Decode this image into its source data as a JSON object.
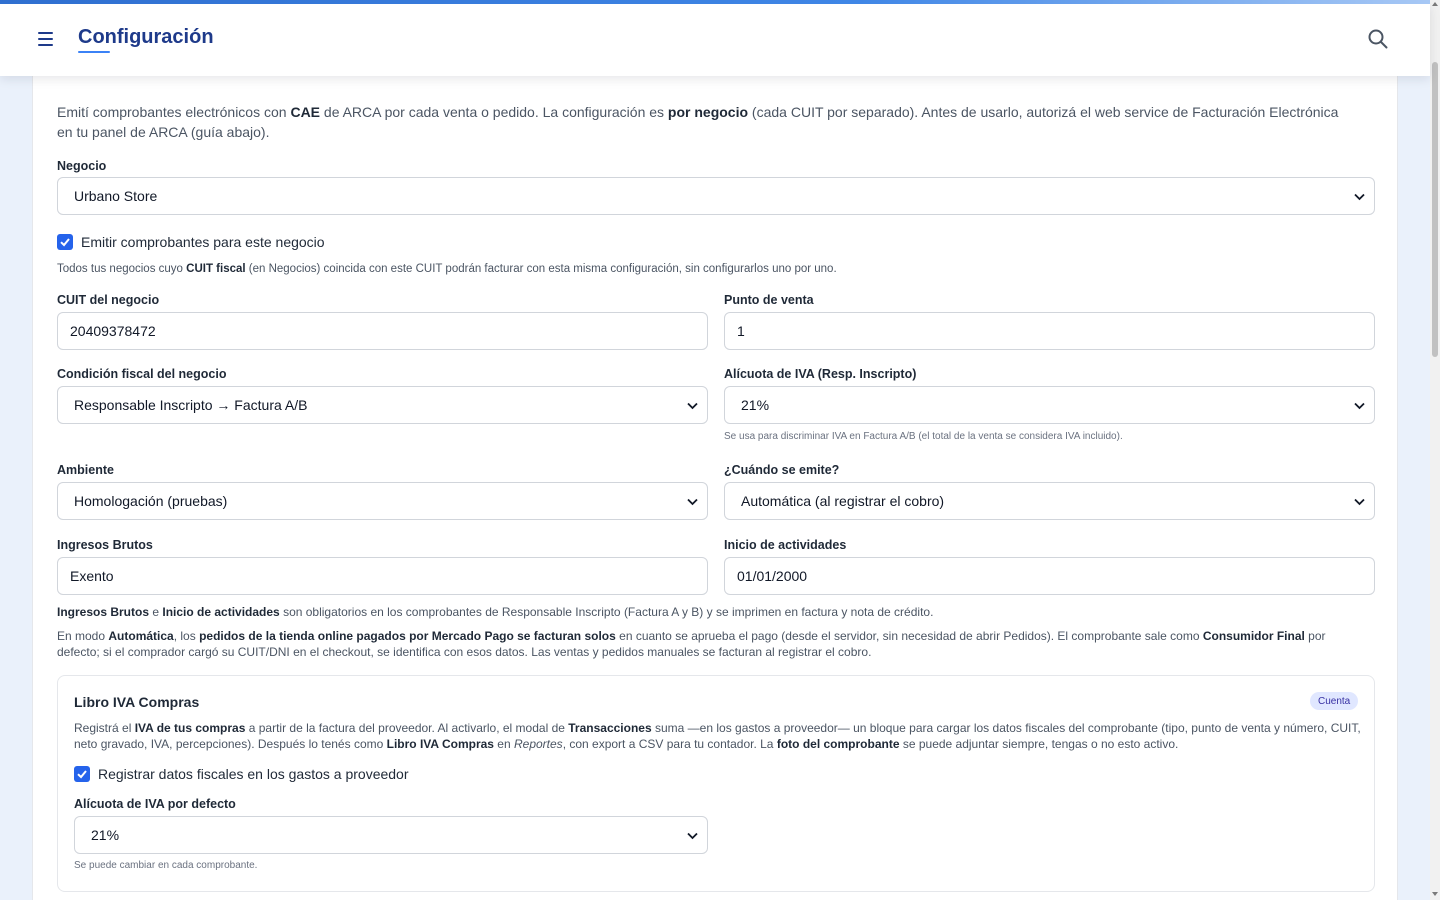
{
  "header": {
    "title": "Configuración"
  },
  "intro": {
    "p1": "Emití comprobantes electrónicos con ",
    "b1": "CAE",
    "p2": " de ARCA por cada venta o pedido. La configuración es ",
    "b2": "por negocio",
    "p3": " (cada CUIT por separado). Antes de usarlo, autorizá el web service de Facturación Electrónica en tu panel de ARCA (guía abajo)."
  },
  "negocio": {
    "label": "Negocio",
    "value": "Urbano Store"
  },
  "emitir": {
    "label": "Emitir comprobantes para este negocio",
    "checked": true,
    "hint_p1": "Todos tus negocios cuyo ",
    "hint_b1": "CUIT fiscal",
    "hint_p2": " (en Negocios) coincida con este CUIT podrán facturar con esta misma configuración, sin configurarlos uno por uno."
  },
  "cuit": {
    "label": "CUIT del negocio",
    "value": "20409378472"
  },
  "punto_venta": {
    "label": "Punto de venta",
    "value": "1"
  },
  "condicion": {
    "label": "Condición fiscal del negocio",
    "value": "Responsable Inscripto → Factura A/B"
  },
  "alicuota": {
    "label": "Alícuota de IVA (Resp. Inscripto)",
    "value": "21%",
    "hint": "Se usa para discriminar IVA en Factura A/B (el total de la venta se considera IVA incluido)."
  },
  "ambiente": {
    "label": "Ambiente",
    "value": "Homologación (pruebas)"
  },
  "cuando": {
    "label": "¿Cuándo se emite?",
    "value": "Automática (al registrar el cobro)"
  },
  "ingresos": {
    "label": "Ingresos Brutos",
    "value": "Exento"
  },
  "inicio": {
    "label": "Inicio de actividades",
    "value": "01/01/2000"
  },
  "note1": {
    "b1": "Ingresos Brutos",
    "p1": " e ",
    "b2": "Inicio de actividades",
    "p2": " son obligatorios en los comprobantes de Responsable Inscripto (Factura A y B) y se imprimen en factura y nota de crédito."
  },
  "note2": {
    "p1": "En modo ",
    "b1": "Automática",
    "p2": ", los ",
    "b2": "pedidos de la tienda online pagados por Mercado Pago se facturan solos",
    "p3": " en cuanto se aprueba el pago (desde el servidor, sin necesidad de abrir Pedidos). El comprobante sale como ",
    "b3": "Consumidor Final",
    "p4": " por defecto; si el comprador cargó su CUIT/DNI en el checkout, se identifica con esos datos. Las ventas y pedidos manuales se facturan al registrar el cobro."
  },
  "libro": {
    "title": "Libro IVA Compras",
    "badge": "Cuenta",
    "d1": "Registrá el ",
    "db1": "IVA de tus compras",
    "d2": " a partir de la factura del proveedor. Al activarlo, el modal de ",
    "db2": "Transacciones",
    "d3": " suma —en los gastos a proveedor— un bloque para cargar los datos fiscales del comprobante (tipo, punto de venta y número, CUIT, neto gravado, IVA, percepciones). Después lo tenés como ",
    "db3": "Libro IVA Compras",
    "d4": " en ",
    "di1": "Reportes",
    "d5": ", con export a CSV para tu contador. La ",
    "db4": "foto del comprobante",
    "d6": " se puede adjuntar siempre, tengas o no esto activo.",
    "checkbox_label": "Registrar datos fiscales en los gastos a proveedor",
    "checked": true,
    "alicuota_label": "Alícuota de IVA por defecto",
    "alicuota_value": "21%",
    "alicuota_hint": "Se puede cambiar en cada comprobante."
  },
  "colors": {
    "accent": "#2563eb",
    "title": "#1e3a8a",
    "background": "#eaf1fb"
  }
}
